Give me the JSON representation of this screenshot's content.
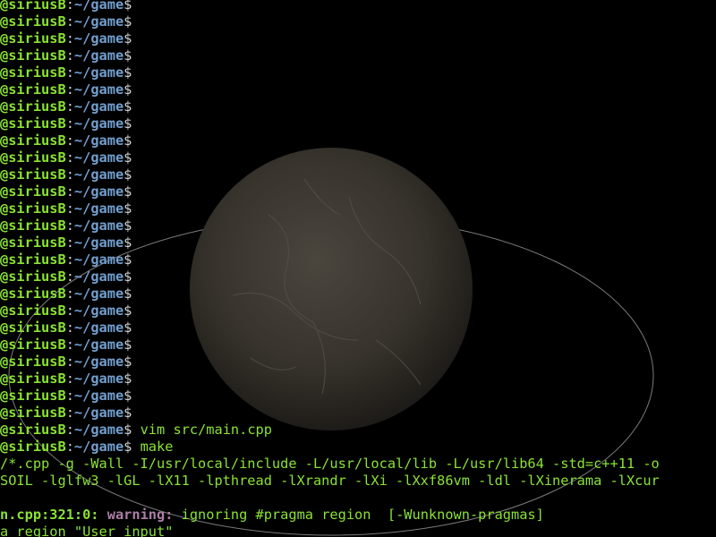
{
  "prompt": {
    "host": "@siriusB",
    "colon": ":",
    "path": "~/game",
    "dollar": "$"
  },
  "empty_prompt_count": 25,
  "commands": [
    " vim src/main.cpp",
    " make"
  ],
  "build_output": [
    "/*.cpp -g -Wall -I/usr/local/include -L/usr/local/lib -L/usr/lib64 -std=c++11 -o",
    "SOIL -lglfw3 -lGL -lX11 -lpthread -lXrandr -lXi -lXxf86vm -ldl -lXinerama -lXcur",
    ""
  ],
  "warning": {
    "location": "n.cpp:321:0:",
    "label": "warning:",
    "message": " ignoring #pragma region  [-Wunknown-pragmas]"
  },
  "last_line": "a region \"User input\"",
  "colors": {
    "background": "#000000",
    "host": "#8ae234",
    "path": "#729fcf",
    "text": "#d0d0d0",
    "warning": "#ad7fa8",
    "planet": "#3a3630",
    "orbit": "#7a7a7a"
  }
}
